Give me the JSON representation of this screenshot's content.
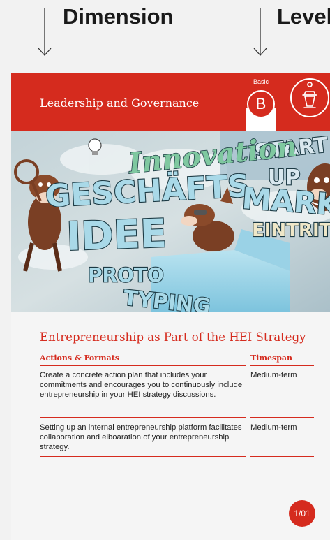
{
  "annotations": {
    "dimension_label": "Dimension",
    "level_label": "Level"
  },
  "card": {
    "dimension_title": "Leadership and Governance",
    "level_caption": "Basic",
    "level_letter": "B",
    "dimension_icon": "lectern-icon",
    "image_words": [
      "Innovation",
      "GESCHÄFTS",
      "IDEE",
      "PROTO",
      "TYPING",
      "START",
      "UP",
      "MARKT",
      "EINTRITT"
    ],
    "section_title": "Entrepreneurship as Part of the HEI Strategy",
    "table": {
      "headers": {
        "actions": "Actions & Formats",
        "timespan": "Timespan"
      },
      "rows": [
        {
          "action": "Create a concrete action plan that includes your commitments and encourages you to continuously include entrepreneurship in your HEI strategy discussions.",
          "timespan": "Medium-term"
        },
        {
          "action": "Setting up an internal entrepreneurship platform facilitates collaboration and elboaration of your entrepreneurship strategy.",
          "timespan": "Medium-term"
        }
      ]
    },
    "page_number": "1/01"
  },
  "colors": {
    "accent": "#d52b1e",
    "background": "#f2f2f2"
  }
}
